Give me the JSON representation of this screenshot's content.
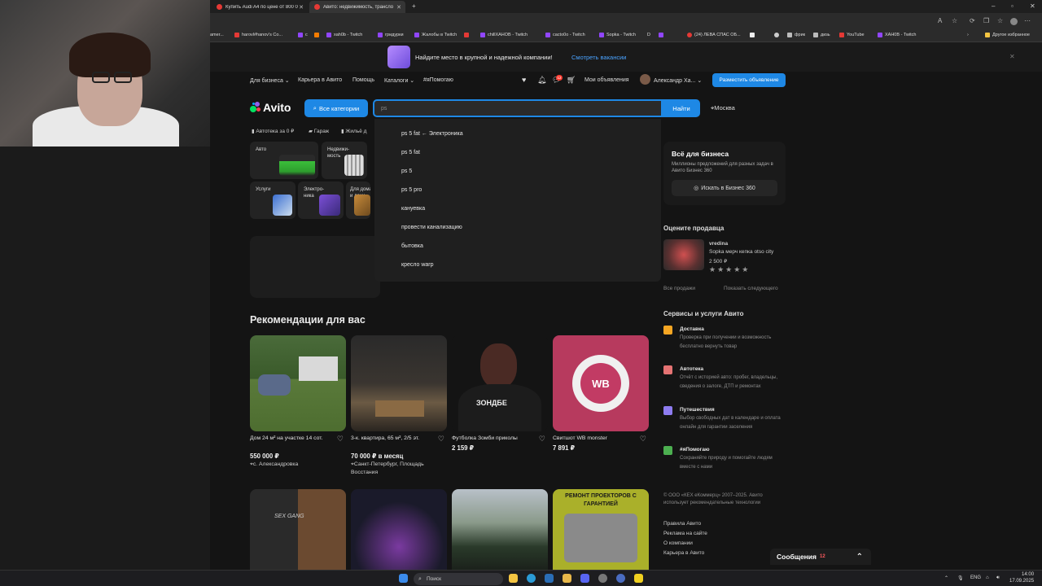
{
  "browser": {
    "tabs": [
      {
        "title": "Купить Audi A4 по цене от 800 0",
        "color": "#e53935"
      },
      {
        "title": "Авито: недвижимость, трансло",
        "color": "#e53935"
      }
    ],
    "bookmarks": [
      "amer...",
      "harovl#hanov's Co...",
      "c",
      "",
      "xah0b - Twitch",
      "гридурки",
      "Жалобы в Twitch",
      "",
      "chillXAHOB - Twitch",
      "cacto0o - Twitch",
      "Sopka - Twitch",
      "",
      "",
      "(24) ЛЕВА СПАС ОБ...",
      "",
      "",
      "фрик",
      "дизь",
      "YouTube",
      "XAH0B - Twitch"
    ],
    "other_bookmarks": "Другое избранное"
  },
  "banner": {
    "text": "Найдите место в крупной и надежной компании!",
    "link": "Смотреть вакансии"
  },
  "nav": {
    "business": "Для бизнеса",
    "career": "Карьера в Авито",
    "help": "Помощь",
    "catalogs": "Каталоги",
    "help_tag": "#яПомогаю",
    "my_ads": "Мои объявления",
    "user": "Александр Ха...",
    "post_ad": "Разместить объявление",
    "notif_count": "12"
  },
  "search": {
    "logo": "Avito",
    "all_categories": "Все категории",
    "query": "ps",
    "find": "Найти",
    "city": "Москва",
    "suggestions": [
      "ps 5 fat ← Электроника",
      "ps 5 fat",
      "ps 5",
      "ps 5 pro",
      "кануевка",
      "провести канализацию",
      "бытовка",
      "кресло warp"
    ]
  },
  "quick_links": [
    "Автотека за 0 ₽",
    "Гараж",
    "Жильё д"
  ],
  "categories": [
    {
      "label": "Авто"
    },
    {
      "label": "Недвижи-мость"
    },
    {
      "label": "Услуги"
    },
    {
      "label": "Электро-ника"
    },
    {
      "label": "Для дома и дачи"
    }
  ],
  "business_box": {
    "title": "Всё для бизнеса",
    "desc": "Миллионы предложений для разных задач в Авито Бизнес 360",
    "button": "Искать в Бизнес 360"
  },
  "rate_seller": {
    "title": "Оцените продавца",
    "seller": "vredina",
    "item": "Sopka мерч кепка otso city",
    "price": "2 500 ₽",
    "all_sales": "Все продажи",
    "show_next": "Показать следующего"
  },
  "services": {
    "title": "Сервисы и услуги Авито",
    "items": [
      {
        "name": "Доставка",
        "desc": "Проверка при получении и возможность бесплатно вернуть товар",
        "color": "#f5a623"
      },
      {
        "name": "Автотека",
        "desc": "Отчёт с историей авто: пробег, владельцы, сведения о залоге, ДТП и ремонтах",
        "color": "#e57373"
      },
      {
        "name": "Путешествия",
        "desc": "Выбор свободных дат в календаре и оплата онлайн для гарантии заселения",
        "color": "#8e7cf0"
      },
      {
        "name": "#яПомогаю",
        "desc": "Сохраняйте природу и помогайте людям вместе с нами",
        "color": "#4caf50"
      }
    ]
  },
  "footer": {
    "copyright": "© ООО «КЕХ еКоммерц» 2007–2025. Авито использует рекомендательные технологии",
    "links": [
      "Правила Авито",
      "Реклама на сайте",
      "О компании",
      "Карьера в Авито"
    ]
  },
  "recommendations": {
    "title": "Рекомендации для вас",
    "cards": [
      {
        "title": "Дом 24 м² на участке 14 сот.",
        "price": "550 000 ₽",
        "location": "с. Александровка"
      },
      {
        "title": "3-к. квартира, 65 м², 2/5 эт.",
        "price": "70 000 ₽ в месяц",
        "location": "Санкт-Петербург, Площадь Восстания"
      },
      {
        "title": "Футболка Зомби приколы",
        "price": "2 159 ₽",
        "location": ""
      },
      {
        "title": "Свитшот WB monster",
        "price": "7 891 ₽",
        "location": ""
      }
    ],
    "row2_banner": "РЕМОНТ ПРОЕКТОРОВ С ГАРАНТИЕЙ",
    "shirt_text": "ЗОНДБЕ",
    "wb": "WB",
    "hoodie_text": "SEX GANG"
  },
  "messages": {
    "label": "Сообщения",
    "count": "12"
  },
  "taskbar": {
    "search": "Поиск",
    "lang": "ENG",
    "time": "14:00",
    "date": "17.09.2025"
  }
}
